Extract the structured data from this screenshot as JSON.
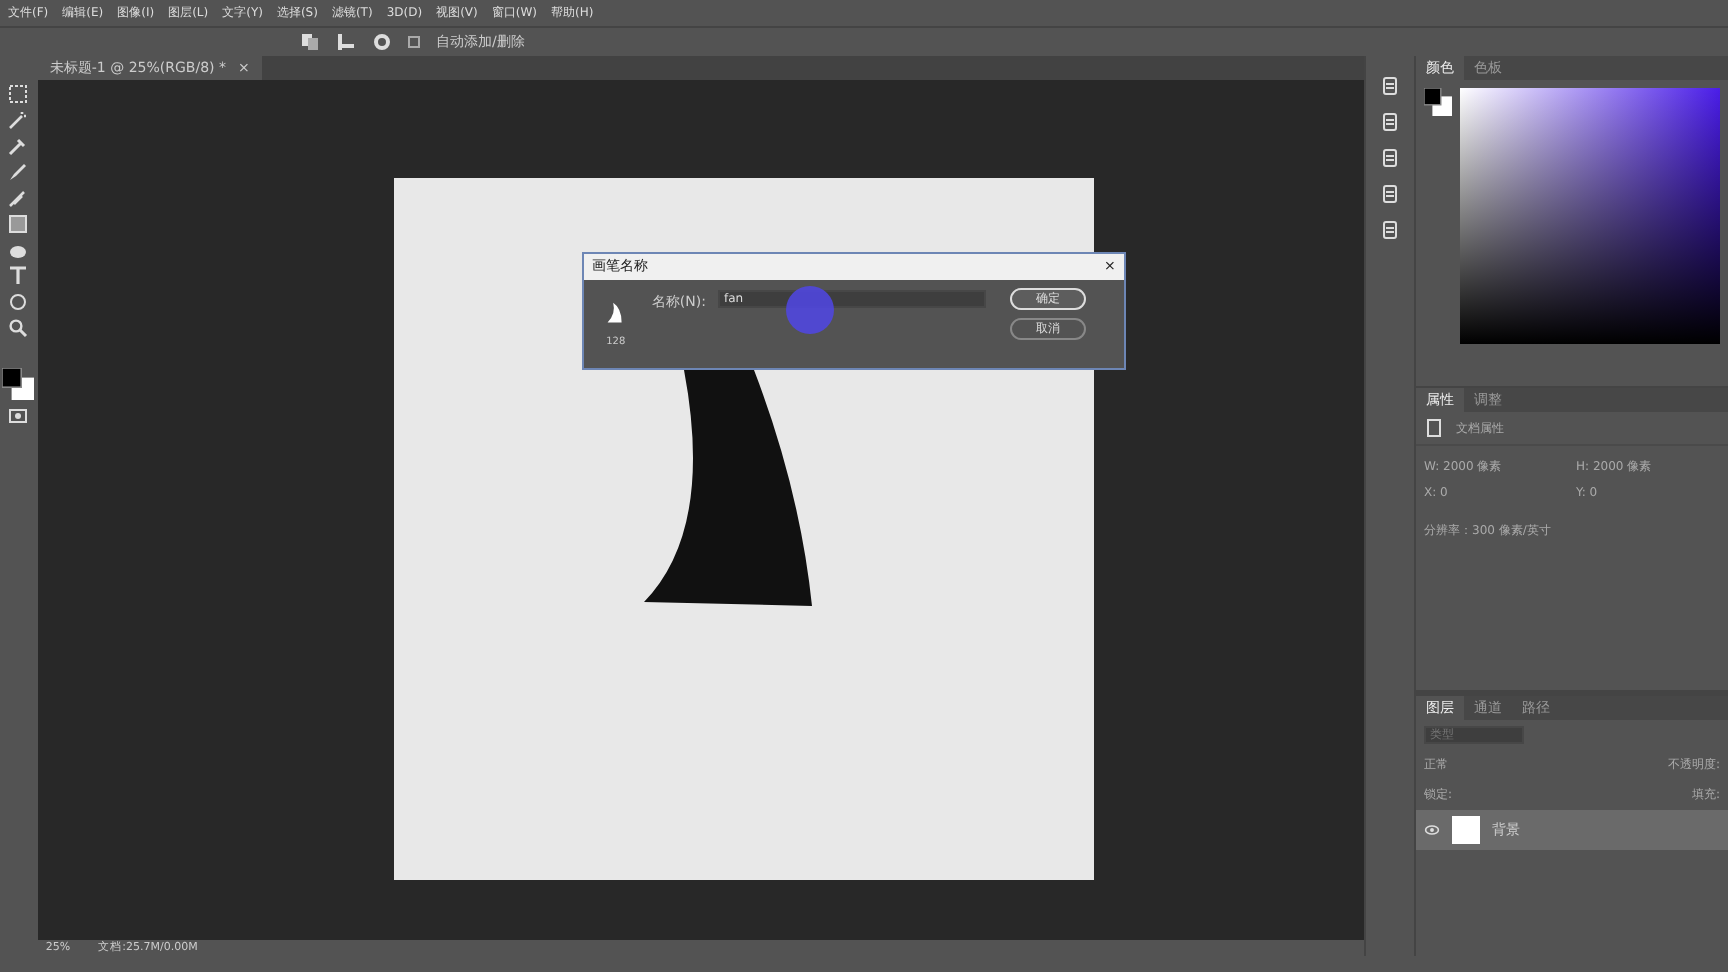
{
  "menu": [
    "文件(F)",
    "编辑(E)",
    "图像(I)",
    "图层(L)",
    "文字(Y)",
    "选择(S)",
    "滤镜(T)",
    "3D(D)",
    "视图(V)",
    "窗口(W)",
    "帮助(H)"
  ],
  "options_bar": {
    "auto_add_label": "自动添加/删除",
    "auto_add_checked": false
  },
  "document_tab": {
    "title": "未标题-1 @ 25%(RGB/8) *",
    "close": "×"
  },
  "dialog": {
    "title": "画笔名称",
    "close": "×",
    "brush_size": "128",
    "label": "名称(N):",
    "value": "fan",
    "buttons": [
      {
        "label": "确定",
        "default": true
      },
      {
        "label": "取消",
        "default": false
      }
    ]
  },
  "color_panel": {
    "tabs": [
      {
        "label": "颜色",
        "selected": true
      },
      {
        "label": "色板",
        "selected": false
      }
    ]
  },
  "properties_panel": {
    "tabs": [
      {
        "label": "属性",
        "selected": true
      },
      {
        "label": "调整",
        "selected": false
      }
    ],
    "heading": "文档属性",
    "fields": [
      "W: 2000 像素",
      "H: 2000 像素",
      "X: 0",
      "Y: 0"
    ],
    "resolution": "分辨率：300 像素/英寸"
  },
  "layers_panel": {
    "tabs": [
      {
        "label": "图层",
        "selected": true
      },
      {
        "label": "通道",
        "selected": false
      },
      {
        "label": "路径",
        "selected": false
      }
    ],
    "filter_placeholder": "类型",
    "blend_mode": "正常",
    "opacity_label": "不透明度:",
    "lock_label": "锁定:",
    "fill_label": "填充:",
    "layers": [
      {
        "name": "背景",
        "visible": true,
        "selected": true
      }
    ]
  },
  "status_bar": {
    "zoom": "25%",
    "document_size": "文档:25.7M/0.00M"
  }
}
